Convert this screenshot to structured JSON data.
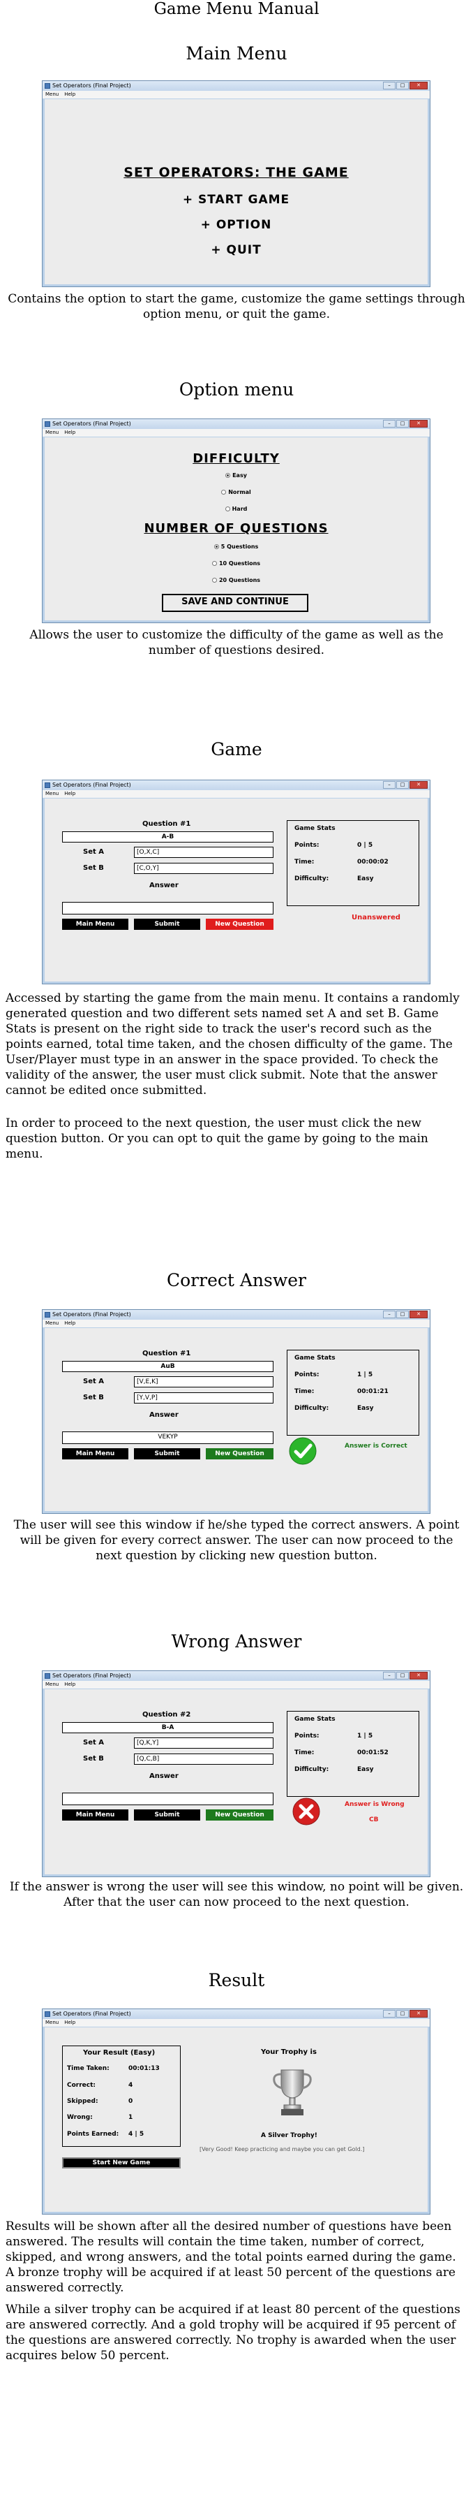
{
  "doc_title": "Game Menu Manual",
  "window": {
    "title": "Set Operators (Final Project)",
    "menu": [
      "Menu",
      "Help"
    ]
  },
  "main_menu": {
    "heading": "Main Menu",
    "screen": {
      "title": "SET OPERATORS: THE GAME",
      "items": [
        "+ START GAME",
        "+ OPTION",
        "+ QUIT"
      ]
    },
    "description": "Contains the option to start the game, customize the game settings through option menu, or quit the game."
  },
  "option_menu": {
    "heading": "Option menu",
    "screen": {
      "difficulty_title": "DIFFICULTY",
      "difficulty_options": [
        "Easy",
        "Normal",
        "Hard"
      ],
      "difficulty_selected": "Easy",
      "questions_title": "NUMBER OF QUESTIONS",
      "question_options": [
        "5 Questions",
        "10 Questions",
        "20 Questions"
      ],
      "questions_selected": "5 Questions",
      "save_label": "SAVE AND CONTINUE"
    },
    "description": "Allows the user to customize the difficulty of the game as well as the number of questions desired."
  },
  "game": {
    "heading": "Game",
    "screen": {
      "question_label": "Question #1",
      "expression": "A-B",
      "set_a_label": "Set A",
      "set_a": "[O,X,C]",
      "set_b_label": "Set B",
      "set_b": "[C,O,Y]",
      "answer_label": "Answer",
      "answer": "",
      "stats_title": "Game Stats",
      "points_label": "Points:",
      "points": "0 | 5",
      "time_label": "Time:",
      "time": "00:00:02",
      "difficulty_label": "Difficulty:",
      "difficulty": "Easy",
      "status": "Unanswered",
      "buttons": {
        "main_menu": "Main Menu",
        "submit": "Submit",
        "new_question": "New Question"
      }
    },
    "description_1": "Accessed by starting the game from the main menu. It contains a randomly generated question and two different sets named set A and set B. Game Stats is present on the right side to track the user's record such as the points earned, total time taken, and the chosen difficulty of the game. The User/Player must type in an answer in the space provided. To check the validity of the answer, the user must click submit. Note that the answer cannot be edited once submitted.",
    "description_2": "In order to proceed to the next question, the user must click the new question button. Or you can opt to quit the game by going to the main menu."
  },
  "correct": {
    "heading": "Correct Answer",
    "screen": {
      "question_label": "Question #1",
      "expression": "AuB",
      "set_a_label": "Set A",
      "set_a": "[V,E,K]",
      "set_b_label": "Set B",
      "set_b": "[Y,V,P]",
      "answer_label": "Answer",
      "answer": "VEKYP",
      "stats_title": "Game Stats",
      "points_label": "Points:",
      "points": "1 | 5",
      "time_label": "Time:",
      "time": "00:01:21",
      "difficulty_label": "Difficulty:",
      "difficulty": "Easy",
      "status": "Answer is Correct",
      "buttons": {
        "main_menu": "Main Menu",
        "submit": "Submit",
        "new_question": "New Question"
      }
    },
    "description": "The user will see this window if he/she typed the correct answers. A point will be given for every correct answer. The user can now proceed to the next question by clicking new question button."
  },
  "wrong": {
    "heading": "Wrong Answer",
    "screen": {
      "question_label": "Question #2",
      "expression": "B-A",
      "set_a_label": "Set A",
      "set_a": "[Q,K,Y]",
      "set_b_label": "Set B",
      "set_b": "[Q,C,B]",
      "answer_label": "Answer",
      "answer": "",
      "stats_title": "Game Stats",
      "points_label": "Points:",
      "points": "1 | 5",
      "time_label": "Time:",
      "time": "00:01:52",
      "difficulty_label": "Difficulty:",
      "difficulty": "Easy",
      "status": "Answer is Wrong",
      "status_sub": "CB",
      "buttons": {
        "main_menu": "Main Menu",
        "submit": "Submit",
        "new_question": "New Question"
      }
    },
    "description": "If the answer is wrong the user will see this window, no point will be given. After that the user can now proceed to the next question."
  },
  "result": {
    "heading": "Result",
    "screen": {
      "result_title": "Your Result (Easy)",
      "rows": [
        {
          "label": "Time Taken:",
          "value": "00:01:13"
        },
        {
          "label": "Correct:",
          "value": "4"
        },
        {
          "label": "Skipped:",
          "value": "0"
        },
        {
          "label": "Wrong:",
          "value": "1"
        },
        {
          "label": "Points Earned:",
          "value": "4 | 5"
        }
      ],
      "start_new_game": "Start New Game",
      "trophy_title": "Your Trophy is",
      "trophy_name": "A Silver Trophy!",
      "trophy_msg": "[Very Good! Keep practicing and maybe you can get Gold.]"
    },
    "description_1": "Results will be shown after all the desired number of questions have been answered. The results will contain the time taken, number of correct, skipped, and wrong answers, and the total points earned during the game. A bronze trophy will be acquired if at least 50 percent of the questions are answered correctly.",
    "description_2": "While a silver trophy can be acquired if at least 80 percent of the questions are answered correctly. And a gold trophy will be acquired if 95 percent of the questions are answered correctly. No trophy is awarded when the user acquires below 50 percent."
  },
  "colors": {
    "red_button": "#e01d1d",
    "green_button": "#1d7a1d",
    "correct_text": "#1d7a1d",
    "wrong_text": "#e01d1d",
    "window_frame": "#b9d0e8"
  }
}
